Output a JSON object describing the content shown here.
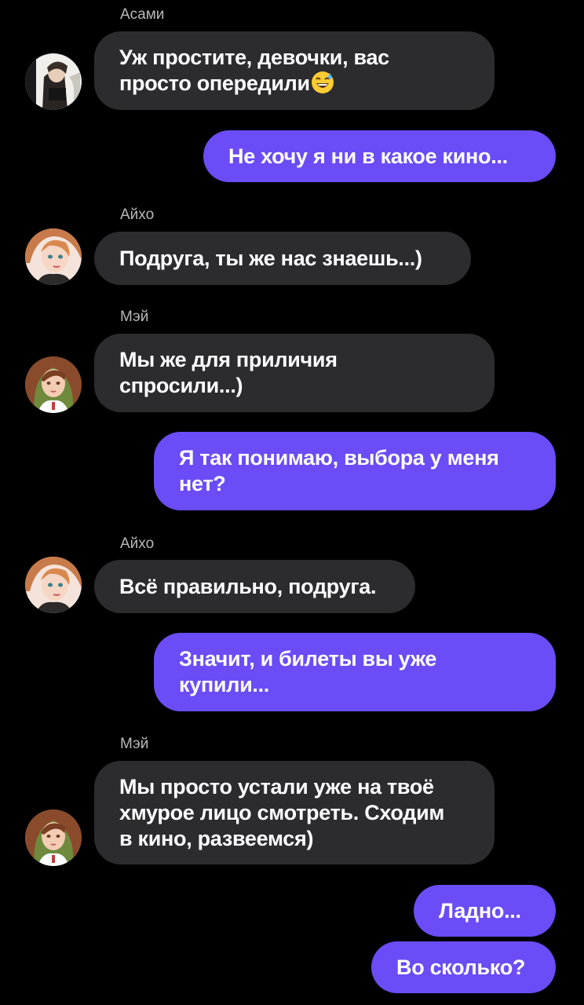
{
  "colors": {
    "background": "#000000",
    "incoming_bubble": "#2c2c2f",
    "outgoing_bubble": "#6b4cf6",
    "sender_name": "#b9b9b9",
    "text": "#ffffff"
  },
  "messages": [
    {
      "sender": "Асами",
      "avatar_icon": "asami-avatar-icon",
      "lines": [
        "Уж простите, девочки, вас",
        "просто опередили"
      ],
      "emoji": "sweat-smile-emoji-icon"
    },
    {
      "sender": "",
      "lines": [
        "Не хочу я ни в какое кино..."
      ]
    },
    {
      "sender": "Айхо",
      "avatar_icon": "aiho-avatar-icon",
      "lines": [
        "Подруга, ты же нас знаешь...)"
      ]
    },
    {
      "sender": "Мэй",
      "avatar_icon": "mei-avatar-icon",
      "lines": [
        "Мы же для приличия",
        "спросили...)"
      ]
    },
    {
      "sender": "",
      "lines": [
        "Я так понимаю, выбора у меня",
        "нет?"
      ]
    },
    {
      "sender": "Айхо",
      "avatar_icon": "aiho-avatar-icon",
      "lines": [
        "Всё правильно, подруга."
      ]
    },
    {
      "sender": "",
      "lines": [
        "Значит, и билеты вы уже",
        "купили..."
      ]
    },
    {
      "sender": "Мэй",
      "avatar_icon": "mei-avatar-icon",
      "lines": [
        "Мы просто устали уже на твоё",
        "хмурое лицо смотреть. Сходим",
        "в кино, развеемся)"
      ]
    },
    {
      "sender": "",
      "lines": [
        "Ладно..."
      ]
    },
    {
      "sender": "",
      "lines": [
        "Во сколько?"
      ]
    }
  ]
}
